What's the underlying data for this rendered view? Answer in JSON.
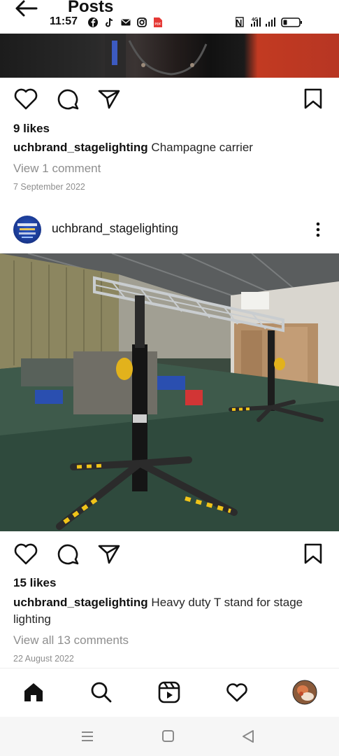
{
  "header": {
    "title": "Posts"
  },
  "status_bar": {
    "time": "11:57",
    "signal": "4G",
    "icons": [
      "facebook-icon",
      "tiktok-icon",
      "mail-icon",
      "instagram-icon",
      "pdf-icon"
    ]
  },
  "posts": [
    {
      "likes": "9 likes",
      "username": "uchbrand_stagelighting",
      "caption": "Champagne carrier",
      "comments_link": "View 1 comment",
      "date": "7 September 2022"
    },
    {
      "username": "uchbrand_stagelighting",
      "likes": "15 likes",
      "caption_line1": "Heavy duty T stand for stage",
      "caption_line2": "lighting",
      "comments_link": "View all 13 comments",
      "date": "22 August 2022"
    }
  ],
  "bottom_nav": [
    "home-icon",
    "search-icon",
    "reels-icon",
    "heart-icon",
    "profile-avatar"
  ],
  "colors": {
    "text": "#262626",
    "muted": "#8e8e8e",
    "accent": "#111111"
  }
}
